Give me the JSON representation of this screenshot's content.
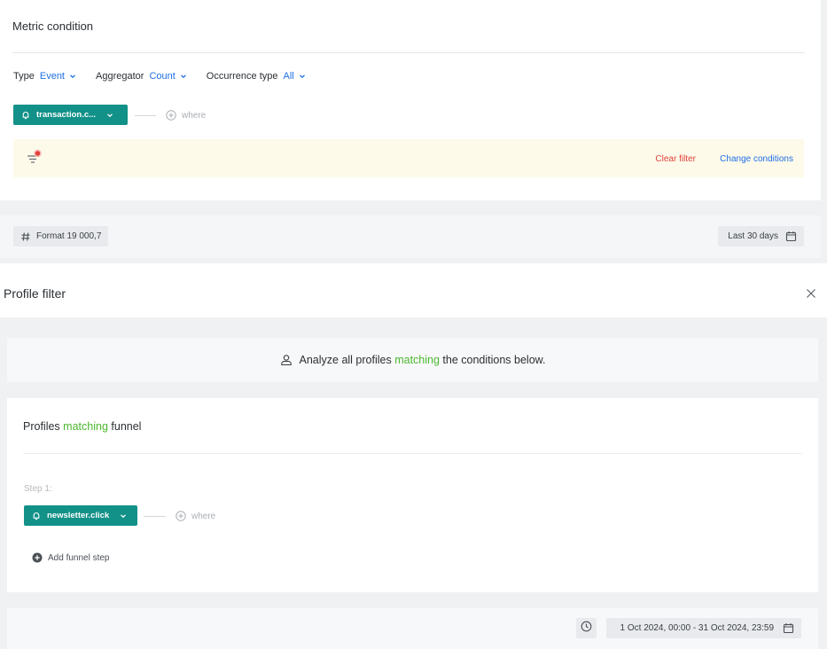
{
  "metric_condition": {
    "title": "Metric condition",
    "type_label": "Type",
    "type_value": "Event",
    "aggregator_label": "Aggregator",
    "aggregator_value": "Count",
    "occurrence_label": "Occurrence type",
    "occurrence_value": "All",
    "event_name": "transaction.c...",
    "where_label": "where",
    "clear_filter": "Clear filter",
    "change_conditions": "Change conditions"
  },
  "format_bar": {
    "format_label": "Format 19 000,7",
    "date_range": "Last 30 days"
  },
  "profile_filter": {
    "title": "Profile filter",
    "analyze_prefix": "Analyze all profiles",
    "analyze_highlight": "matching",
    "analyze_suffix": "the conditions below.",
    "funnel_prefix": "Profiles",
    "funnel_highlight": "matching",
    "funnel_suffix": "funnel",
    "step_label": "Step 1:",
    "step_event": "newsletter.click",
    "where_label": "where",
    "add_step": "Add funnel step",
    "date_range": "1 Oct 2024, 00:00 - 31 Oct 2024, 23:59"
  },
  "colors": {
    "accent_blue": "#1f6fe5",
    "event_teal": "#129188",
    "highlight_green": "#4cb82e",
    "danger_red": "#e0413b",
    "filter_band": "#fdfaea"
  },
  "icons": {
    "event": "bell-icon",
    "filter": "filter-icon",
    "format": "hash-icon",
    "calendar": "calendar-icon",
    "close": "close-icon",
    "person": "person-icon",
    "add": "plus-circle-icon",
    "clock": "clock-icon"
  }
}
